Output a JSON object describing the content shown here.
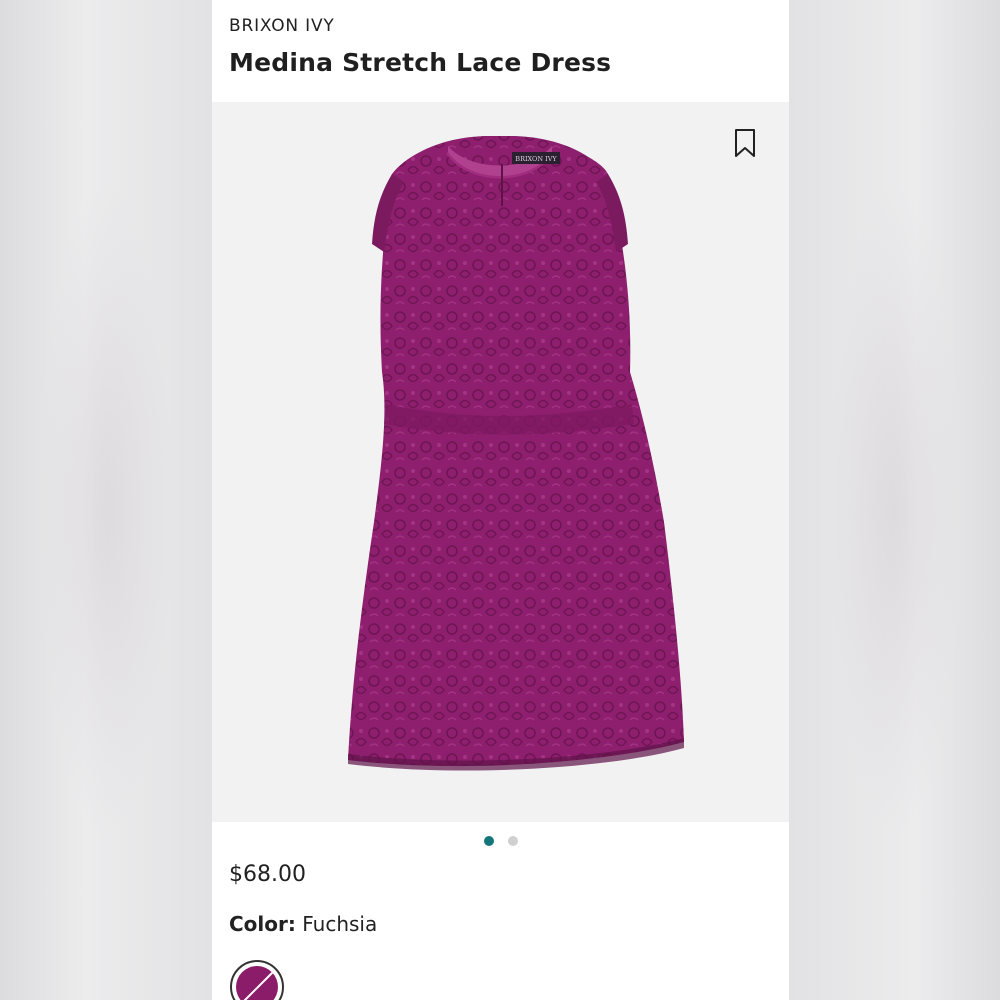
{
  "product": {
    "brand": "BRIXON IVY",
    "name": "Medina Stretch Lace Dress",
    "price": "$68.00",
    "color_label": "Color:",
    "color_value": "Fuchsia",
    "image_tag_text": "BRIXON IVY"
  },
  "carousel": {
    "total": 2,
    "active_index": 0
  },
  "icons": {
    "bookmark": "bookmark-icon"
  },
  "colors": {
    "dress": "#8e1f6e",
    "dress_dark": "#6e1553",
    "accent_dot": "#13777a",
    "swatch": "#8a1c6a"
  }
}
